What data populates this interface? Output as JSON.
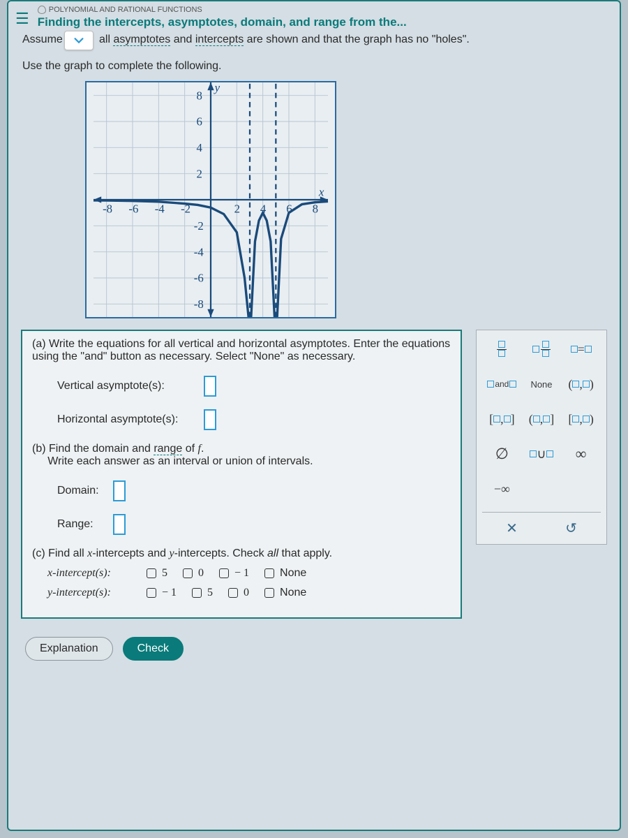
{
  "header": {
    "crumb": "POLYNOMIAL AND RATIONAL FUNCTIONS",
    "title": "Finding the intercepts, asymptotes, domain, and range from the..."
  },
  "intro": {
    "assume_word": "Assume",
    "text_prefix": "all ",
    "asymptotes": "asymptotes",
    "mid": " and ",
    "intercepts": "intercepts",
    "text_suffix": " are shown and that the graph has no \"holes\"."
  },
  "sub": "Use the graph to complete the following.",
  "partA": {
    "label": "(a) Write the equations for all vertical and horizontal asymptotes. Enter the equations using the \"and\" button as necessary. Select \"None\" as necessary.",
    "vertical_label": "Vertical asymptote(s):",
    "horizontal_label": "Horizontal asymptote(s):"
  },
  "partB": {
    "prefix": "(b) Find the domain and ",
    "range_word": "range",
    "suffix": " of ",
    "func": "f",
    "line2": "Write each answer as an interval or union of intervals.",
    "domain_label": "Domain:",
    "range_label": "Range:"
  },
  "partC": {
    "prefix": "(c) Find all ",
    "xint": "x",
    "mid1": "-intercepts and ",
    "yint": "y",
    "mid2": "-intercepts. Check ",
    "all_word": "all",
    "suffix": " that apply.",
    "xrow_label": "x-intercept(s):",
    "yrow_label": "y-intercept(s):",
    "x_options": [
      "5",
      "0",
      "− 1",
      "None"
    ],
    "y_options": [
      "− 1",
      "5",
      "0",
      "None"
    ]
  },
  "palette": {
    "r1": [
      "frac",
      "mixed",
      "eq"
    ],
    "r2_and": "and",
    "r2_none": "None",
    "r2_open": "(□,□)",
    "r3": [
      "[□,□]",
      "(□,□]",
      "[□,□)"
    ],
    "r4_empty": "∅",
    "r4_union": "□∪□",
    "r4_inf": "∞",
    "r5_neginf": "−∞"
  },
  "buttons": {
    "explanation": "Explanation",
    "check": "Check"
  },
  "chart_data": {
    "type": "line",
    "title": "",
    "xlabel": "x",
    "ylabel": "y",
    "xlim": [
      -9,
      9
    ],
    "ylim": [
      -9,
      9
    ],
    "x_ticks": [
      -8,
      -6,
      -4,
      -2,
      2,
      4,
      6,
      8
    ],
    "y_ticks": [
      -8,
      -6,
      -4,
      -2,
      2,
      4,
      6,
      8
    ],
    "vertical_asymptotes": [
      3,
      5
    ],
    "horizontal_asymptotes": [
      0
    ],
    "series": [
      {
        "name": "left branch",
        "x": [
          -9,
          -8,
          -6,
          -4,
          -2,
          -1,
          0,
          1,
          2,
          2.6,
          2.9
        ],
        "y": [
          -0.05,
          -0.06,
          -0.09,
          -0.15,
          -0.3,
          -0.4,
          -0.6,
          -1.1,
          -2.5,
          -6,
          -9
        ]
      },
      {
        "name": "middle branch",
        "x": [
          3.1,
          3.4,
          3.7,
          4,
          4.3,
          4.6,
          4.9
        ],
        "y": [
          -9,
          -3.2,
          -1.6,
          -1,
          -1.6,
          -3.2,
          -9
        ]
      },
      {
        "name": "right branch",
        "x": [
          5.1,
          5.4,
          6,
          7,
          8,
          9
        ],
        "y": [
          -9,
          -3,
          -1,
          -0.35,
          -0.2,
          -0.13
        ]
      }
    ],
    "intercepts": {
      "x": [],
      "y": []
    }
  }
}
